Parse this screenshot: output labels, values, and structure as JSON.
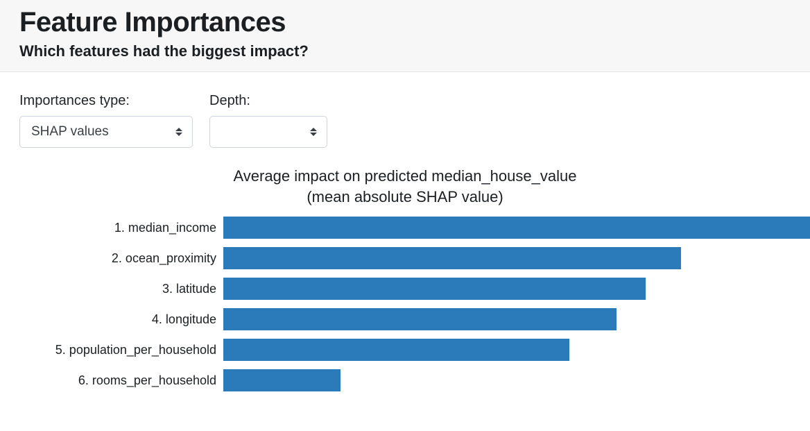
{
  "header": {
    "title": "Feature Importances",
    "subtitle": "Which features had the biggest impact?"
  },
  "controls": {
    "importances_type": {
      "label": "Importances type:",
      "value": "SHAP values"
    },
    "depth": {
      "label": "Depth:",
      "value": ""
    }
  },
  "chart_data": {
    "type": "bar",
    "orientation": "horizontal",
    "title": "Average impact on predicted median_house_value\n(mean absolute SHAP value)",
    "xlabel": "",
    "ylabel": "",
    "x_range_fraction": [
      0,
      1
    ],
    "categories": [
      "1. median_income",
      "2. ocean_proximity",
      "3. latitude",
      "4. longitude",
      "5. population_per_household",
      "6. rooms_per_household"
    ],
    "values": [
      1.0,
      0.78,
      0.72,
      0.67,
      0.59,
      0.2
    ],
    "bar_color": "#2b7bba"
  }
}
